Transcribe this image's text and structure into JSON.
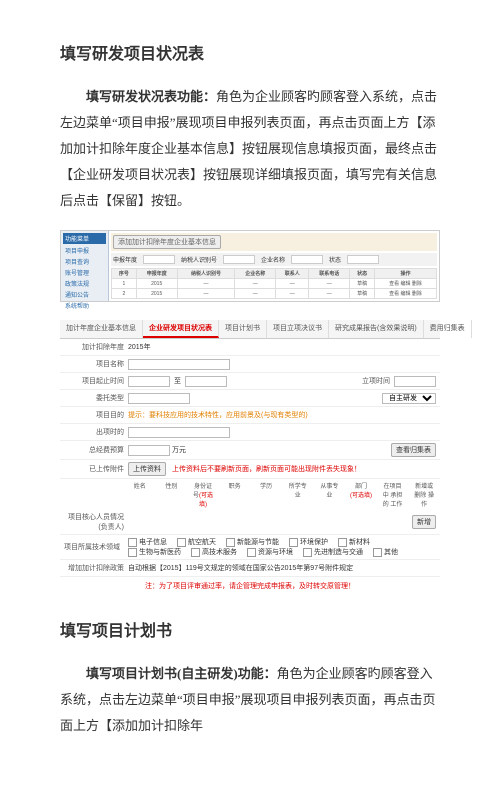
{
  "heading1": "填写研发项目状况表",
  "para1_lead": "填写研发状况表功能：",
  "para1_rest": "角色为企业顾客旳顾客登入系统，点击左边菜单“项目申报”展现项目申报列表页面，再点击页面上方【添加加计扣除年度企业基本信息】按钮展现信息填报页面，最终点击【企业研发项目状况表】按钮展现详细填报页面，填写完有关信息后点击【保留】按钮。",
  "shot1": {
    "side_hdr": "功能菜单",
    "side_items": [
      "项目申报",
      "项目查询",
      "账号管理",
      "政策法规",
      "通知公告",
      "系统帮助"
    ],
    "filter_labels": [
      "申报年度",
      "纳税人识别号",
      "企业名称",
      "状态"
    ],
    "btn_add": "添加加计扣除年度企业基本信息",
    "th": [
      "序号",
      "申报年度",
      "纳税人识别号",
      "企业名称",
      "联系人",
      "联系电话",
      "状态",
      "操作"
    ],
    "row1": [
      "1",
      "2015",
      "—",
      "—",
      "—",
      "—",
      "草稿",
      "查看 编辑 删除"
    ],
    "row2": [
      "2",
      "2015",
      "—",
      "—",
      "—",
      "—",
      "草稿",
      "查看 编辑 删除"
    ]
  },
  "shot2": {
    "tabs": [
      "加计年度企业基本信息",
      "企业研发项目状况表",
      "项目计划书",
      "项目立项决议书",
      "研究成果报告(含效果说明)",
      "费用归集表"
    ],
    "active_tab_idx": 1,
    "rows": {
      "year_lbl": "加计扣除年度",
      "year_val": "2015年",
      "name_lbl": "项目名称",
      "reg_lbl": "项目起止时间",
      "to": "至",
      "reg_time_lbl": "立项时间",
      "type_lbl": "委托类型",
      "type_opt": "自主研发",
      "purpose_lbl": "项目目的",
      "purpose_tip": "提示：要科技应用的技术特性，应用前景及(与现有类型的)",
      "record_lbl": "出项时的",
      "budget_lbl": "总经费预算",
      "wan": "万元",
      "upload_lbl": "已上传附件",
      "upload_btn": "上传资料",
      "upload_tip": "上传资料后不要刷新页面，刷新页面可能出现附件丢失现象！",
      "person_lbl": "项目核心人员情况(负责人)",
      "ph": [
        "姓名",
        "性别",
        "身份证号",
        "职务",
        "学历",
        "所学专业",
        "从事专业",
        "部门",
        "在项目中 承担的 工作",
        "新增或删除 操作"
      ],
      "ph_red1": "(可选填)",
      "ph_red2": "(可选填)",
      "tech_lbl": "项目所属技术领域",
      "tech_opts": [
        "电子信息",
        "航空航天",
        "新能源与节能",
        "环境保护",
        "新材料",
        "生物与新医药",
        "高技术服务",
        "资源与环境",
        "先进制造与交通",
        "其他"
      ],
      "policy_lbl": "增加加计扣除政策",
      "policy_val": "自动根据【2015】119号文规定的领域在国家公告2015年第97号附件规定",
      "footer_note": "注：为了项目评审通过率，请企管理完成申报表，及时转交原管理！"
    }
  },
  "heading2": "填写项目计划书",
  "para2_lead": "填写项目计划书(自主研发)功能：",
  "para2_rest": "角色为企业顾客旳顾客登入系统，点击左边菜单“项目申报”展现项目申报列表页面，再点击页面上方【添加加计扣除年"
}
